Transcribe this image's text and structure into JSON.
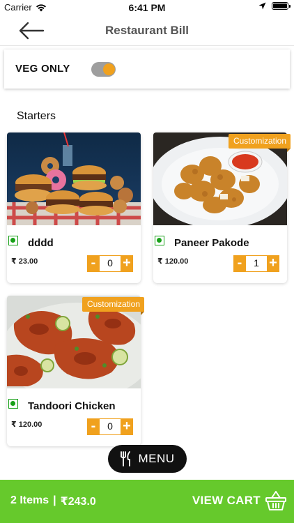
{
  "status_bar": {
    "carrier": "Carrier",
    "time": "6:41 PM"
  },
  "nav": {
    "title": "Restaurant Bill"
  },
  "filter": {
    "veg_only_label": "VEG ONLY",
    "veg_only_enabled": true
  },
  "section": {
    "title": "Starters"
  },
  "dishes": [
    {
      "name": "dddd",
      "price": "₹ 23.00",
      "quantity": "0",
      "customization": "",
      "minus": "-",
      "plus": "+"
    },
    {
      "name": "Paneer Pakode",
      "price": "₹ 120.00",
      "quantity": "1",
      "customization": "Customization",
      "minus": "-",
      "plus": "+"
    },
    {
      "name": "Tandoori Chicken",
      "price": "₹ 120.00",
      "quantity": "0",
      "customization": "Customization",
      "minus": "-",
      "plus": "+"
    }
  ],
  "menu_button": {
    "label": "MENU"
  },
  "cart": {
    "items": "2 Items",
    "separator": "|",
    "total": "₹243.0",
    "view_cart_label": "VIEW CART"
  },
  "colors": {
    "accent": "#f0a11e",
    "cart_bar": "#66c92c",
    "veg_green": "#18a018",
    "fab": "#111111"
  },
  "icons": [
    "wifi-icon",
    "location-arrow-icon",
    "battery-icon",
    "back-arrow-icon",
    "veg-indicator-icon",
    "fork-knife-icon",
    "shopping-basket-icon"
  ]
}
